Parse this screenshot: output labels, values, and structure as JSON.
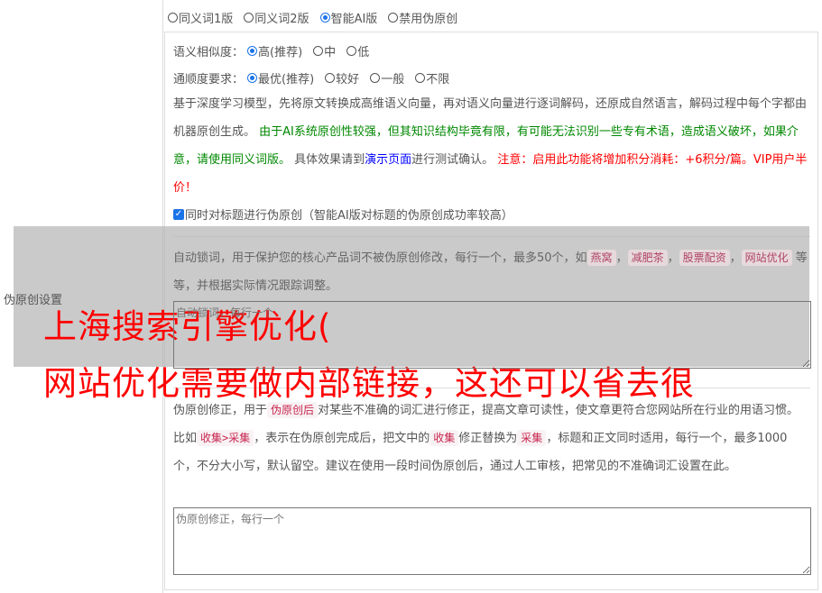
{
  "mode_options": [
    {
      "label": "同义词1版",
      "checked": false
    },
    {
      "label": "同义词2版",
      "checked": false
    },
    {
      "label": "智能AI版",
      "checked": true
    },
    {
      "label": "禁用伪原创",
      "checked": false
    }
  ],
  "similarity": {
    "label": "语义相似度：",
    "options": [
      {
        "label": "高(推荐)",
        "checked": true
      },
      {
        "label": "中",
        "checked": false
      },
      {
        "label": "低",
        "checked": false
      }
    ]
  },
  "fluency": {
    "label": "通顺度要求：",
    "options": [
      {
        "label": "最优(推荐)",
        "checked": true
      },
      {
        "label": "较好",
        "checked": false
      },
      {
        "label": "一般",
        "checked": false
      },
      {
        "label": "不限",
        "checked": false
      }
    ]
  },
  "description": {
    "intro": "基于深度学习模型，先将原文转换成高维语义向量，再对语义向量进行逐词解码，还原成自然语言，解码过程中每个字都由机器原创生成。",
    "warning_green": " 由于AI系统原创性较强，但其知识结构毕竟有限，有可能无法识别一些专有术语，造成语义破坏，如果介意，请使用同义词版。",
    "test_prefix": " 具体效果请到",
    "demo_link": "演示页面",
    "test_suffix": "进行测试确认。",
    "notice_red": " 注意：启用此功能将增加积分消耗：+6积分/篇。VIP用户半价！"
  },
  "title_checkbox": {
    "label": "同时对标题进行伪原创（智能AI版对标题的伪原创成功率较高）",
    "checked": true
  },
  "section_label": "伪原创设置",
  "lock_words": {
    "text_before": "自动锁词，用于保护您的核心产品词不被伪原创修改，每行一个，最多50个，如",
    "examples": [
      "燕窝",
      "减肥茶",
      "股票配资",
      "网站优化"
    ],
    "separator": "，",
    "text_after": " 等等，并根据实际情况跟踪调整。",
    "placeholder": "自动锁词，每行一个"
  },
  "correction": {
    "t1": "伪原创修正，用于",
    "c1": "伪原创后",
    "t2": "对某些不准确的词汇进行修正，提高文章可读性，使文章更符合您网站所在行业的用语习惯。比如",
    "c2": "收集>采集",
    "t3": "，表示在伪原创完成后，把文中的",
    "c3": "收集",
    "t4": "修正替换为",
    "c4": "采集",
    "t5": "，标题和正文同时适用，每行一个，最多1000个，不分大小写，默认留空。建议在使用一段时间伪原创后，通过人工审核，把常见的不准确词汇设置在此。",
    "placeholder": "伪原创修正，每行一个"
  },
  "watermark": {
    "line1": "上海搜索引擎优化(",
    "line2": "网站优化需要做内部链接，这还可以省去很"
  }
}
